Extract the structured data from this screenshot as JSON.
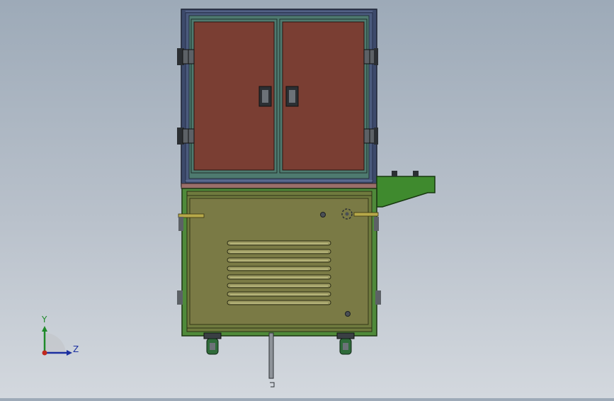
{
  "viewport": {
    "triad": {
      "y_label": "Y",
      "z_label": "Z"
    },
    "colors": {
      "frame": "#3d4a6b",
      "door_panel": "#7a3e33",
      "door_frame": "#4e7a6f",
      "cabinet_body": "#7a7a45",
      "cabinet_frame": "#4f8a3a",
      "shelf_bracket": "#3f8a2e",
      "wheel": "#2f6b3a"
    },
    "model": {
      "upper_cabinet": {
        "door_count": 2,
        "hinge_count": 4
      },
      "lower_cabinet": {
        "vent_slot_count": 8
      },
      "caster_count": 2
    }
  }
}
